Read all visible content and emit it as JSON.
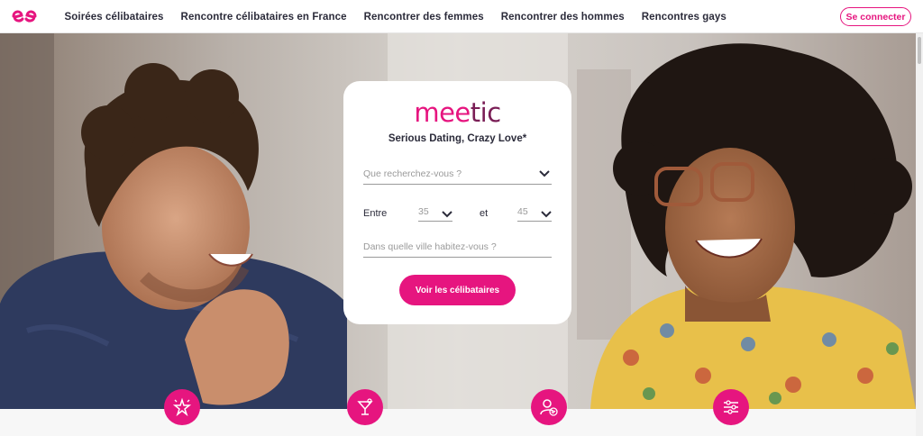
{
  "nav": {
    "items": [
      {
        "label": "Soirées célibataires"
      },
      {
        "label": "Rencontre célibataires en France"
      },
      {
        "label": "Rencontrer des femmes"
      },
      {
        "label": "Rencontrer des hommes"
      },
      {
        "label": "Rencontres gays"
      }
    ],
    "login_label": "Se connecter"
  },
  "search_card": {
    "brand_left": "mee",
    "brand_right": "tic",
    "tagline": "Serious Dating, Crazy Love*",
    "looking_for": {
      "placeholder": "Que recherchez-vous ?"
    },
    "age": {
      "between_label": "Entre",
      "min": "35",
      "and_label": "et",
      "max": "45"
    },
    "city": {
      "placeholder": "Dans quelle ville habitez-vous ?"
    },
    "cta_label": "Voir les célibataires"
  },
  "feature_icons": [
    "sparkle-star-icon",
    "cocktail-glass-icon",
    "verified-user-icon",
    "sliders-icon"
  ],
  "colors": {
    "accent": "#e6157f",
    "brand_dark": "#7a1e56",
    "text": "#2b2b3a"
  }
}
